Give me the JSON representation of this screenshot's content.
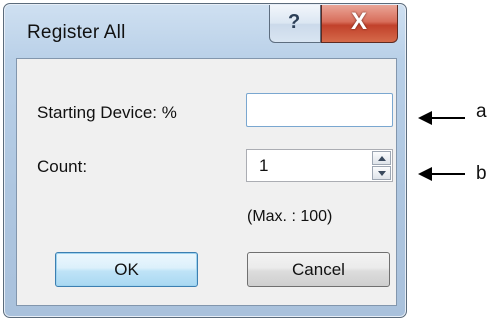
{
  "window": {
    "title": "Register All",
    "help_glyph": "?",
    "close_glyph": "X"
  },
  "form": {
    "starting_device_label": "Starting Device: %",
    "starting_device_value": "",
    "count_label": "Count:",
    "count_value": "1",
    "max_note": "(Max. : 100)"
  },
  "buttons": {
    "ok_label": "OK",
    "cancel_label": "Cancel"
  },
  "callouts": {
    "a": "a",
    "b": "b"
  },
  "icons": {
    "help": "question-icon",
    "close": "close-icon",
    "spin_up": "arrow-up-icon",
    "spin_down": "arrow-down-icon"
  }
}
